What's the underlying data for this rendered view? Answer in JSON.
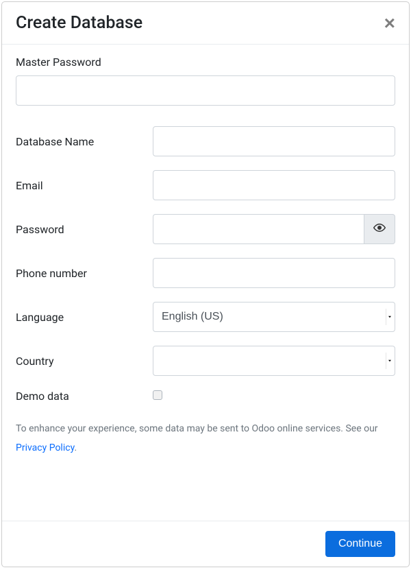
{
  "modal": {
    "title": "Create Database"
  },
  "form": {
    "master_password_label": "Master Password",
    "master_password_value": "",
    "db_name_label": "Database Name",
    "db_name_value": "",
    "email_label": "Email",
    "email_value": "",
    "password_label": "Password",
    "password_value": "",
    "phone_label": "Phone number",
    "phone_value": "",
    "language_label": "Language",
    "language_value": "English (US)",
    "country_label": "Country",
    "country_value": "",
    "demo_label": "Demo data"
  },
  "disclaimer": {
    "text_prefix": "To enhance your experience, some data may be sent to Odoo online services. See our ",
    "link_text": "Privacy Policy",
    "text_suffix": "."
  },
  "footer": {
    "continue_label": "Continue"
  }
}
